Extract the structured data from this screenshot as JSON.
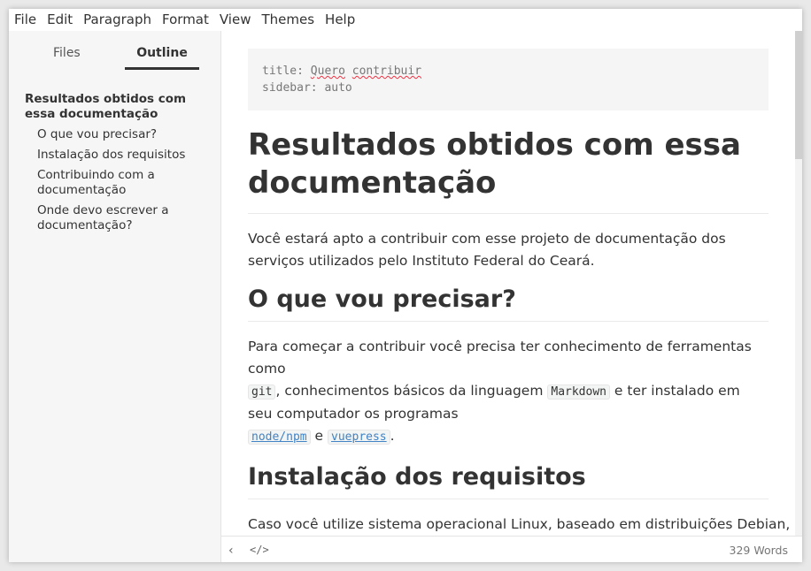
{
  "menu": [
    "File",
    "Edit",
    "Paragraph",
    "Format",
    "View",
    "Themes",
    "Help"
  ],
  "sidebar": {
    "tabs": {
      "files": "Files",
      "outline": "Outline"
    },
    "outline": {
      "h1": "Resultados obtidos com essa documentação",
      "items": [
        "O que vou precisar?",
        "Instalação dos requisitos",
        "Contribuindo com a documentação",
        "Onde devo escrever a documentação?"
      ]
    }
  },
  "editor": {
    "frontmatter": {
      "title_key": "title: ",
      "title_value_1": "Quero",
      "title_value_2": "contribuir",
      "sidebar_line": "sidebar: auto"
    },
    "h1": "Resultados obtidos com essa documentação",
    "intro": "Você estará apto a contribuir com esse projeto de documentação dos serviços utilizados pelo Instituto Federal do Ceará.",
    "h2_need": "O que vou precisar?",
    "need": {
      "t1": "Para começar a contribuir você precisa ter conhecimento de ferramentas como",
      "code_git": "git",
      "t2": ", conhecimentos básicos da linguagem ",
      "code_markdown": "Markdown",
      "t3": " e ter instalado em seu computador os programas",
      "code_node": "node/npm",
      "t4": " e ",
      "code_vuepress": "vuepress",
      "t5": "."
    },
    "h2_install": "Instalação dos requisitos",
    "install_partial": "Caso você utilize sistema operacional Linux, baseado em distribuições Debian,"
  },
  "status": {
    "back_icon": "chevron-left",
    "source_icon": "code",
    "word_count": "329 Words"
  }
}
